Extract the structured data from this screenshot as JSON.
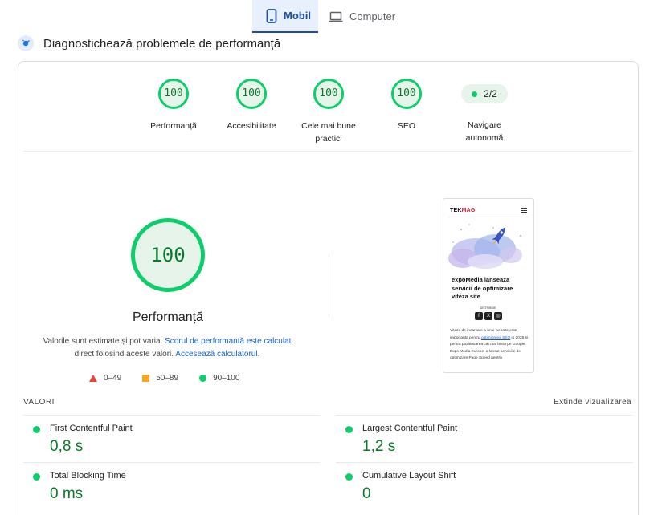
{
  "tabs": [
    {
      "label": "Mobil",
      "active": true,
      "icon": "smartphone-icon"
    },
    {
      "label": "Computer",
      "active": false,
      "icon": "laptop-icon"
    }
  ],
  "diagnostics": {
    "title": "Diagnostichează problemele de performanță",
    "icon": "performance-diagnostic-icon"
  },
  "categories": [
    {
      "score": "100",
      "label": "Performanță"
    },
    {
      "score": "100",
      "label": "Accesibilitate"
    },
    {
      "score": "100",
      "label": "Cele mai bune practici"
    },
    {
      "score": "100",
      "label": "SEO"
    }
  ],
  "navigation": {
    "value": "2/2",
    "label": "Navigare autonomă"
  },
  "performance": {
    "score": "100",
    "title": "Performanță",
    "desc_plain_1": "Valorile sunt estimate și pot varia. ",
    "desc_link_1": "Scorul de performanță este calculat",
    "desc_plain_2": " direct folosind aceste valori. ",
    "desc_link_2": "Accesează calculatorul."
  },
  "legend": [
    {
      "label": "0–49",
      "shape": "triangle",
      "color": "#eb4334"
    },
    {
      "label": "50–89",
      "shape": "square",
      "color": "#f6a623"
    },
    {
      "label": "90–100",
      "shape": "circle",
      "color": "#0cce6b"
    }
  ],
  "screenshot": {
    "logo_a": "TEK",
    "logo_b": "MAG",
    "headline": "expoMedia lanseaza servicii de optimizare viteza site",
    "share_label": "DISTRIBUIE:",
    "social": [
      "f",
      "X",
      "◎"
    ],
    "body_1": "Viteza de incarcare a unui website este importanta pentru ",
    "body_link": "optimizarea SEO",
    "body_2": " in 2025 si pentru pozitionarea cat mai buna pe Google. Expo Media Europe, a lansat serviciile de optimizare Page Speed pentru"
  },
  "metrics_header": {
    "title": "VALORI",
    "expand": "Extinde vizualizarea"
  },
  "metrics": [
    {
      "name": "First Contentful Paint",
      "value": "0,8 s"
    },
    {
      "name": "Largest Contentful Paint",
      "value": "1,2 s"
    },
    {
      "name": "Total Blocking Time",
      "value": "0 ms"
    },
    {
      "name": "Cumulative Layout Shift",
      "value": "0"
    }
  ],
  "colors": {
    "pass": "#0cce6b",
    "pass_text": "#0a7a2a",
    "accent": "#1a4ea8",
    "link": "#1967d2"
  }
}
